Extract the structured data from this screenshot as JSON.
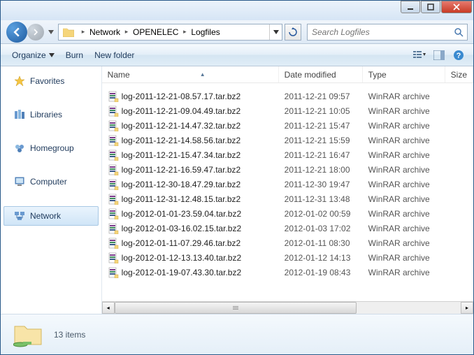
{
  "breadcrumb": {
    "segments": [
      "Network",
      "OPENELEC",
      "Logfiles"
    ]
  },
  "search": {
    "placeholder": "Search Logfiles"
  },
  "toolbar": {
    "organize": "Organize",
    "burn": "Burn",
    "newfolder": "New folder"
  },
  "sidebar": {
    "items": [
      {
        "label": "Favorites",
        "icon": "star"
      },
      {
        "label": "Libraries",
        "icon": "libraries"
      },
      {
        "label": "Homegroup",
        "icon": "homegroup"
      },
      {
        "label": "Computer",
        "icon": "computer"
      },
      {
        "label": "Network",
        "icon": "network",
        "selected": true
      }
    ]
  },
  "columns": {
    "name": "Name",
    "date": "Date modified",
    "type": "Type",
    "size": "Size"
  },
  "files": [
    {
      "name": "log-2011-12-21-08.57.17.tar.bz2",
      "date": "2011-12-21 09:57",
      "type": "WinRAR archive"
    },
    {
      "name": "log-2011-12-21-09.04.49.tar.bz2",
      "date": "2011-12-21 10:05",
      "type": "WinRAR archive"
    },
    {
      "name": "log-2011-12-21-14.47.32.tar.bz2",
      "date": "2011-12-21 15:47",
      "type": "WinRAR archive"
    },
    {
      "name": "log-2011-12-21-14.58.56.tar.bz2",
      "date": "2011-12-21 15:59",
      "type": "WinRAR archive"
    },
    {
      "name": "log-2011-12-21-15.47.34.tar.bz2",
      "date": "2011-12-21 16:47",
      "type": "WinRAR archive"
    },
    {
      "name": "log-2011-12-21-16.59.47.tar.bz2",
      "date": "2011-12-21 18:00",
      "type": "WinRAR archive"
    },
    {
      "name": "log-2011-12-30-18.47.29.tar.bz2",
      "date": "2011-12-30 19:47",
      "type": "WinRAR archive"
    },
    {
      "name": "log-2011-12-31-12.48.15.tar.bz2",
      "date": "2011-12-31 13:48",
      "type": "WinRAR archive"
    },
    {
      "name": "log-2012-01-01-23.59.04.tar.bz2",
      "date": "2012-01-02 00:59",
      "type": "WinRAR archive"
    },
    {
      "name": "log-2012-01-03-16.02.15.tar.bz2",
      "date": "2012-01-03 17:02",
      "type": "WinRAR archive"
    },
    {
      "name": "log-2012-01-11-07.29.46.tar.bz2",
      "date": "2012-01-11 08:30",
      "type": "WinRAR archive"
    },
    {
      "name": "log-2012-01-12-13.13.40.tar.bz2",
      "date": "2012-01-12 14:13",
      "type": "WinRAR archive"
    },
    {
      "name": "log-2012-01-19-07.43.30.tar.bz2",
      "date": "2012-01-19 08:43",
      "type": "WinRAR archive"
    }
  ],
  "status": {
    "text": "13 items"
  }
}
